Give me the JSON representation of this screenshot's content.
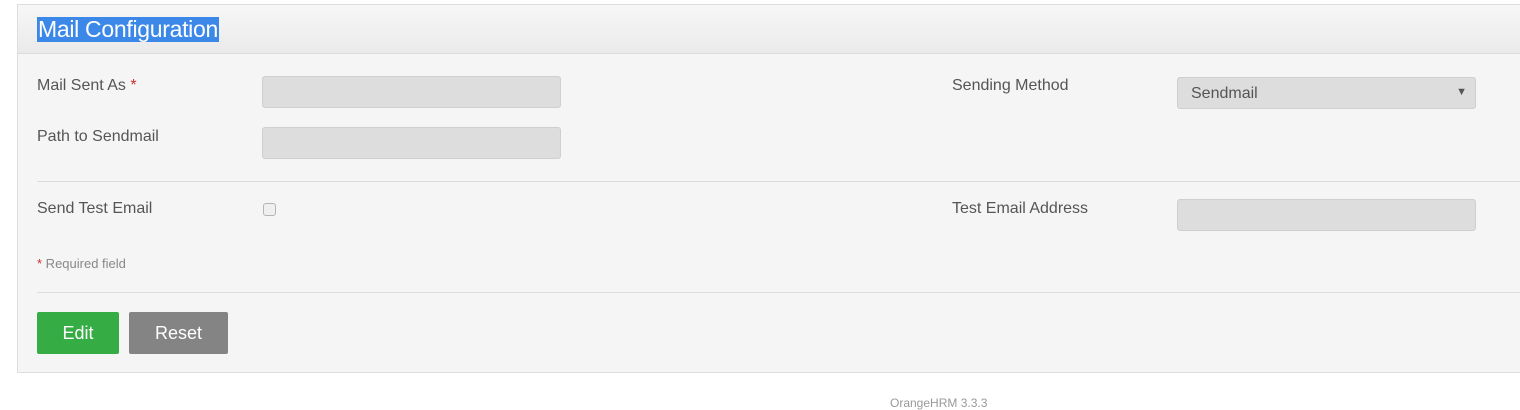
{
  "panel": {
    "title": "Mail Configuration"
  },
  "form": {
    "mail_sent_as_label": "Mail Sent As",
    "required_star": "*",
    "mail_sent_as_value": "",
    "path_to_sendmail_label": "Path to Sendmail",
    "path_to_sendmail_value": "",
    "sending_method_label": "Sending Method",
    "sending_method_value": "Sendmail",
    "send_test_email_label": "Send Test Email",
    "send_test_email_checked": false,
    "test_email_address_label": "Test Email Address",
    "test_email_address_value": "",
    "required_note_star": "*",
    "required_note_text": " Required field"
  },
  "actions": {
    "edit_label": "Edit",
    "reset_label": "Reset"
  },
  "footer": {
    "text": "OrangeHRM 3.3.3"
  },
  "colors": {
    "edit_button": "#36ac45",
    "reset_button": "#848484",
    "title_highlight": "#3b88e8",
    "required_star": "#c9302c"
  },
  "icons": {
    "select_caret": "chevron-down-icon"
  }
}
